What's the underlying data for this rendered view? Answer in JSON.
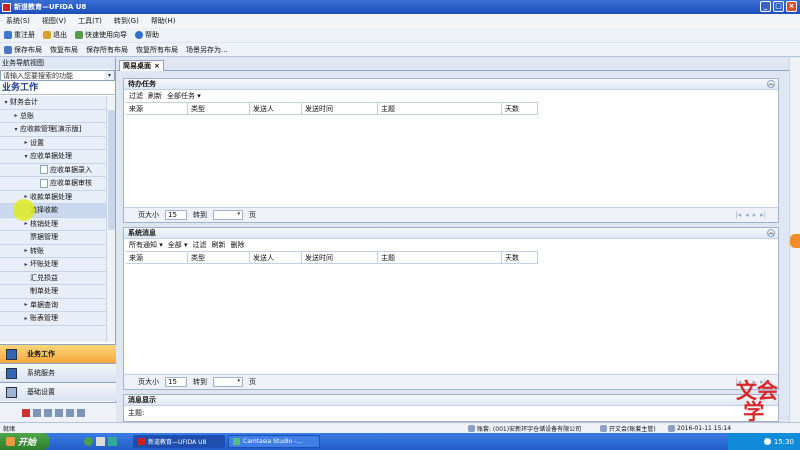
{
  "window": {
    "title": "新道教育—UFIDA U8"
  },
  "menu": [
    "系统(S)",
    "视图(V)",
    "工具(T)",
    "转到(G)",
    "帮助(H)"
  ],
  "toolbar1": [
    {
      "icon": "switch-icon",
      "label": "重注册"
    },
    {
      "icon": "exit-icon",
      "label": "退出"
    },
    {
      "icon": "wizard-icon",
      "label": "快速使用向导"
    },
    {
      "icon": "help-icon",
      "label": "帮助"
    }
  ],
  "toolbar2": [
    {
      "icon": "save-icon",
      "label": "保存布局"
    },
    {
      "label": "恢复布局"
    },
    {
      "label": "保存所有布局"
    },
    {
      "label": "恢复所有布局"
    },
    {
      "label": "场景另存为..."
    }
  ],
  "nav": {
    "header": "业务导航视图",
    "search_placeholder": "请输入您要搜索的功能",
    "title": "业务工作",
    "tree": [
      {
        "label": "财务会计",
        "indent": 0,
        "arrow": "▾",
        "selected": false
      },
      {
        "label": "总账",
        "indent": 1,
        "arrow": "▸",
        "selected": false
      },
      {
        "label": "应收款管理[演示版]",
        "indent": 1,
        "arrow": "▾",
        "selected": false
      },
      {
        "label": "设置",
        "indent": 2,
        "arrow": "▸",
        "selected": false
      },
      {
        "label": "应收单据处理",
        "indent": 2,
        "arrow": "▾",
        "selected": false
      },
      {
        "label": "应收单据录入",
        "indent": 3,
        "arrow": "",
        "selected": false
      },
      {
        "label": "应收单据审核",
        "indent": 3,
        "arrow": "",
        "selected": false
      },
      {
        "label": "收款单据处理",
        "indent": 2,
        "arrow": "▸",
        "selected": false
      },
      {
        "label": "选择收款",
        "indent": 2,
        "arrow": "",
        "selected": true
      },
      {
        "label": "核销处理",
        "indent": 2,
        "arrow": "▸",
        "selected": false
      },
      {
        "label": "票据管理",
        "indent": 2,
        "arrow": "",
        "selected": false
      },
      {
        "label": "转账",
        "indent": 2,
        "arrow": "▸",
        "selected": false
      },
      {
        "label": "坏账处理",
        "indent": 2,
        "arrow": "▸",
        "selected": false
      },
      {
        "label": "汇兑损益",
        "indent": 2,
        "arrow": "",
        "selected": false
      },
      {
        "label": "制单处理",
        "indent": 2,
        "arrow": "",
        "selected": false
      },
      {
        "label": "单据查询",
        "indent": 2,
        "arrow": "▸",
        "selected": false
      },
      {
        "label": "账表管理",
        "indent": 2,
        "arrow": "▸",
        "selected": false
      }
    ],
    "buttons": [
      "业务工作",
      "系统服务",
      "基础设置"
    ]
  },
  "main": {
    "tab": "简易桌面",
    "todo": {
      "title": "待办任务",
      "actions": [
        "过滤",
        "刷新",
        "全部任务 ▾"
      ],
      "columns": [
        "来源",
        "类型",
        "发送人",
        "发送时间",
        "主题",
        "天数"
      ],
      "page_size_label": "页大小",
      "page_size": "15",
      "goto_label": "转到",
      "page_label": "页"
    },
    "messages": {
      "title": "系统消息",
      "actions": [
        "所有通知 ▾",
        "全部 ▾",
        "过滤",
        "刷新",
        "删除"
      ],
      "columns": [
        "来源",
        "类型",
        "发送人",
        "发送时间",
        "主题",
        "天数"
      ],
      "page_size_label": "页大小",
      "page_size": "15",
      "goto_label": "转到",
      "page_label": "页"
    },
    "preview": {
      "title": "消息显示",
      "subject_label": "主题:"
    }
  },
  "statusbar": {
    "ready": "就绪",
    "account": "账套: (001)安新环宇仓储设备有限公司",
    "operator": "开文会(账套主管)",
    "date": "2016-01-11 15:14"
  },
  "taskbar": {
    "start": "开始",
    "items": [
      "新道教育—UFIDA U8",
      "Camtasia Studio -..."
    ],
    "clock": "15:30"
  },
  "watermark": "文会\n学",
  "colors": {
    "accent": "#f2a93b",
    "titlebar": "#1d4fb8",
    "watermark": "#d8282b"
  }
}
